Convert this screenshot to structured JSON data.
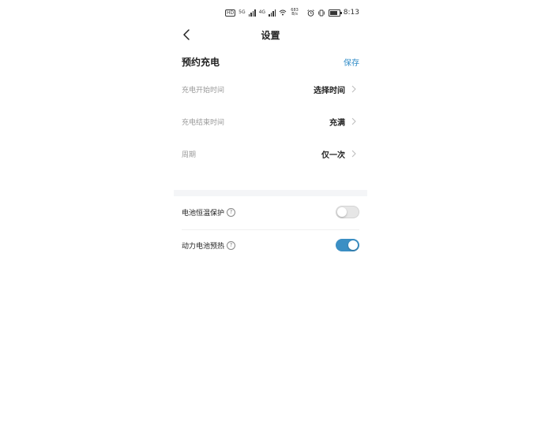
{
  "status_bar": {
    "network_tag": "HD",
    "signal1_tag": "5G",
    "signal2_tag": "4G",
    "speed": "683 B/s",
    "time": "8:13",
    "icons": [
      "alarm-icon",
      "vibrate-icon",
      "battery-icon",
      "wifi-icon"
    ]
  },
  "nav": {
    "title": "设置",
    "back_icon": "chevron-left-icon"
  },
  "section": {
    "title": "预约充电",
    "save_label": "保存"
  },
  "schedule_rows": [
    {
      "label": "充电开始时间",
      "value": "选择时间"
    },
    {
      "label": "充电结束时间",
      "value": "充满"
    },
    {
      "label": "周期",
      "value": "仅一次"
    }
  ],
  "toggles": [
    {
      "label": "电池恒温保护",
      "help": "?",
      "on": false
    },
    {
      "label": "动力电池预热",
      "help": "?",
      "on": true
    }
  ],
  "colors": {
    "accent": "#2f8bc7",
    "toggle_on": "#3b8fc4",
    "band": "#f4f5f7"
  }
}
